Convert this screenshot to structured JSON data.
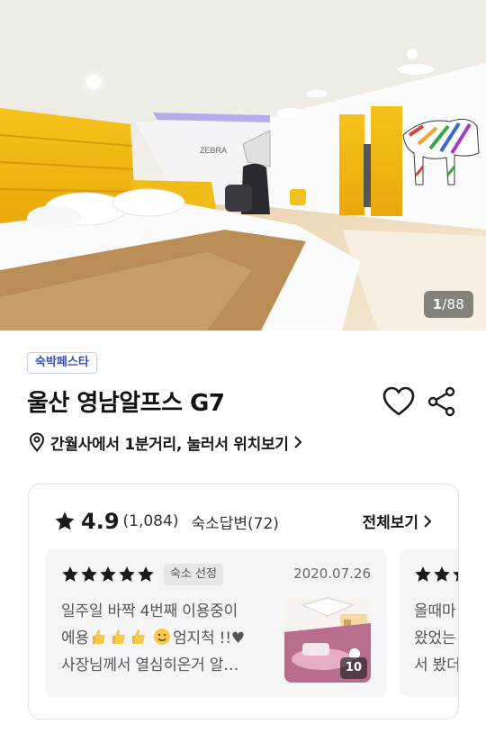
{
  "gallery": {
    "current": "1",
    "total": "/88"
  },
  "badge": "숙박페스타",
  "title": "울산 영남알프스 G7",
  "location": "간월사에서 1분거리, 눌러서 위치보기",
  "reviews": {
    "rating": "4.9",
    "count": "(1,084)",
    "owner_replies": "숙소답변(72)",
    "see_all": "전체보기",
    "cards": [
      {
        "stars": 5,
        "tag": "숙소 선정",
        "date": "2020.07.26",
        "line1": "일주일 바짝 4번째 이용중이",
        "line2_text": "에용",
        "line2_after": "엄지척 !!♥",
        "line3": "사장님께서 열심히온거 알…",
        "photo_count": "10"
      },
      {
        "stars": 3,
        "line1": "올때마",
        "line2": "왔었는",
        "line3": "서 봤더"
      }
    ]
  },
  "colors": {
    "accent": "#3a4bc6",
    "star": "#1a1a1a",
    "card_bg": "#f5f5f7"
  }
}
